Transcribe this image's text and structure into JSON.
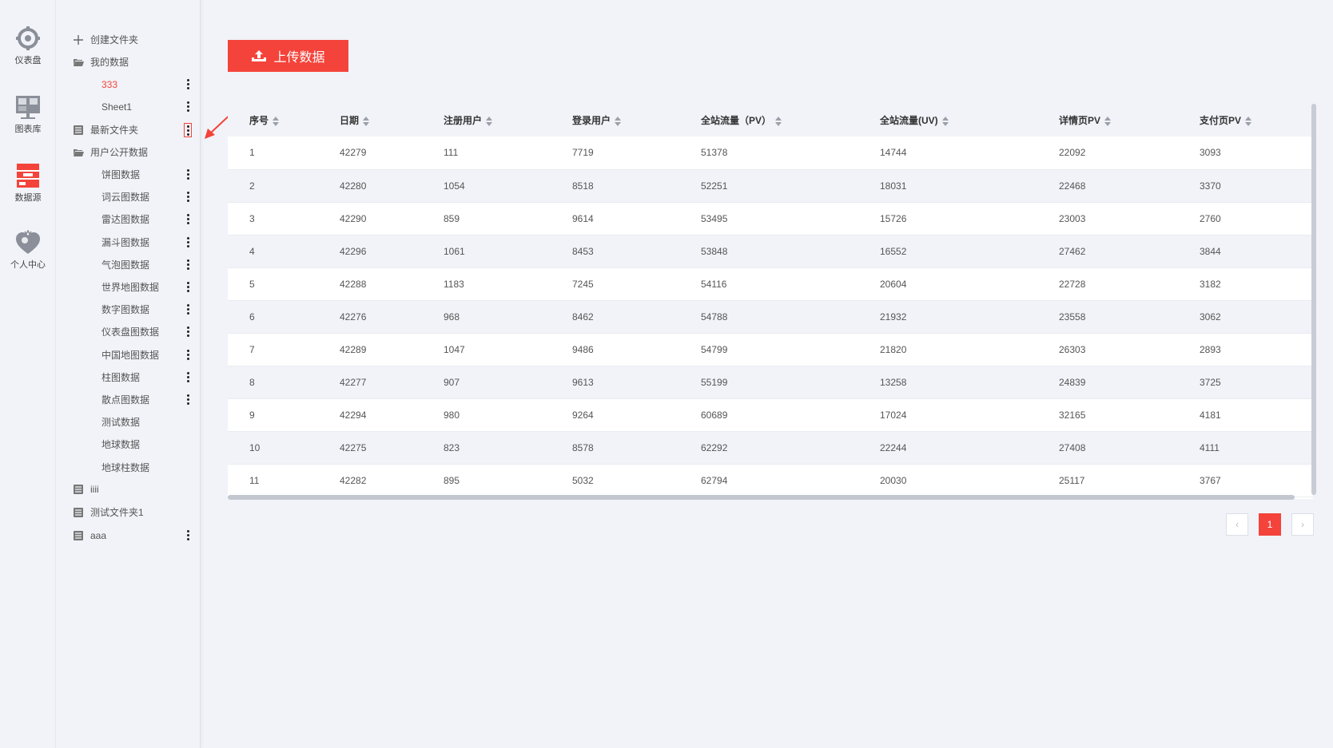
{
  "rail": [
    {
      "label": "仪表盘",
      "icon": "dashboard-gear-icon"
    },
    {
      "label": "图表库",
      "icon": "chart-library-icon"
    },
    {
      "label": "数据源",
      "icon": "data-source-icon"
    },
    {
      "label": "个人中心",
      "icon": "personal-center-heart-icon"
    }
  ],
  "tree": {
    "create_folder": "创建文件夹",
    "my_data": "我的数据",
    "my_data_items": [
      "333",
      "Sheet1"
    ],
    "latest_folder": "最新文件夹",
    "public_data": "用户公开数据",
    "public_items": [
      "饼图数据",
      "词云图数据",
      "雷达图数据",
      "漏斗图数据",
      "气泡图数据",
      "世界地图数据",
      "数字图数据",
      "仪表盘图数据",
      "中国地图数据",
      "柱图数据",
      "散点图数据",
      "测试数据",
      "地球数据",
      "地球柱数据"
    ],
    "folder_iiii": "iiii",
    "folder_test": "测试文件夹1",
    "folder_aaa": "aaa"
  },
  "upload_label": "上传数据",
  "table": {
    "headers": [
      "序号",
      "日期",
      "注册用户",
      "登录用户",
      "全站流量（PV）",
      "全站流量(UV)",
      "详情页PV",
      "支付页PV"
    ],
    "rows": [
      [
        "1",
        "42279",
        "111",
        "7719",
        "51378",
        "14744",
        "22092",
        "3093"
      ],
      [
        "2",
        "42280",
        "1054",
        "8518",
        "52251",
        "18031",
        "22468",
        "3370"
      ],
      [
        "3",
        "42290",
        "859",
        "9614",
        "53495",
        "15726",
        "23003",
        "2760"
      ],
      [
        "4",
        "42296",
        "1061",
        "8453",
        "53848",
        "16552",
        "27462",
        "3844"
      ],
      [
        "5",
        "42288",
        "1183",
        "7245",
        "54116",
        "20604",
        "22728",
        "3182"
      ],
      [
        "6",
        "42276",
        "968",
        "8462",
        "54788",
        "21932",
        "23558",
        "3062"
      ],
      [
        "7",
        "42289",
        "1047",
        "9486",
        "54799",
        "21820",
        "26303",
        "2893"
      ],
      [
        "8",
        "42277",
        "907",
        "9613",
        "55199",
        "13258",
        "24839",
        "3725"
      ],
      [
        "9",
        "42294",
        "980",
        "9264",
        "60689",
        "17024",
        "32165",
        "4181"
      ],
      [
        "10",
        "42275",
        "823",
        "8578",
        "62292",
        "22244",
        "27408",
        "4111"
      ],
      [
        "11",
        "42282",
        "895",
        "5032",
        "62794",
        "20030",
        "25117",
        "3767"
      ]
    ]
  },
  "pagination": {
    "prev": "‹",
    "current": "1",
    "next": "›"
  },
  "colors": {
    "accent": "#f4433a",
    "panel_bg": "#f1f3f8"
  }
}
